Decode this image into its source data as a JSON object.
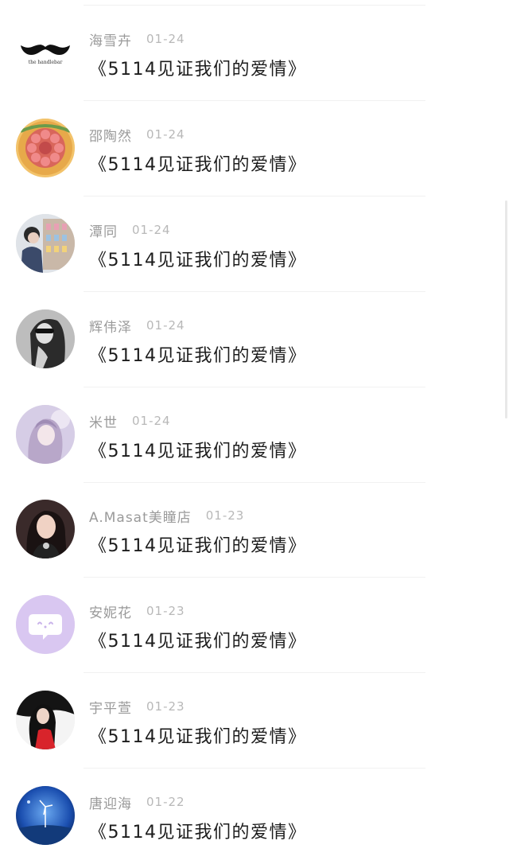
{
  "comments": [
    {
      "name": "海雪卉",
      "date": "01-24",
      "text": "《5114见证我们的爱情》",
      "avatar": "mustache-logo",
      "avatar_text": "the handlebar"
    },
    {
      "name": "邵陶然",
      "date": "01-24",
      "text": "《5114见证我们的爱情》",
      "avatar": "flower-cookie"
    },
    {
      "name": "潭同",
      "date": "01-24",
      "text": "《5114见证我们的爱情》",
      "avatar": "girl-in-store"
    },
    {
      "name": "辉伟泽",
      "date": "01-24",
      "text": "《5114见证我们的爱情》",
      "avatar": "bw-sunglasses-girl"
    },
    {
      "name": "米世",
      "date": "01-24",
      "text": "《5114见证我们的爱情》",
      "avatar": "anime-girl"
    },
    {
      "name": "A.Masat美瞳店",
      "date": "01-23",
      "text": "《5114见证我们的爱情》",
      "avatar": "selfie-girl"
    },
    {
      "name": "安妮花",
      "date": "01-23",
      "text": "《5114见证我们的爱情》",
      "avatar": "chat-bubble-default"
    },
    {
      "name": "宇平萱",
      "date": "01-23",
      "text": "《5114见证我们的爱情》",
      "avatar": "red-dress-girl"
    },
    {
      "name": "唐迎海",
      "date": "01-22",
      "text": "《5114见证我们的爱情》",
      "avatar": "blue-sky-windmill"
    }
  ],
  "colors": {
    "name": "#9a9a9a",
    "date": "#b8b8b8",
    "message": "#1c1c1c",
    "default_avatar_bg": "#d9c7f1"
  }
}
